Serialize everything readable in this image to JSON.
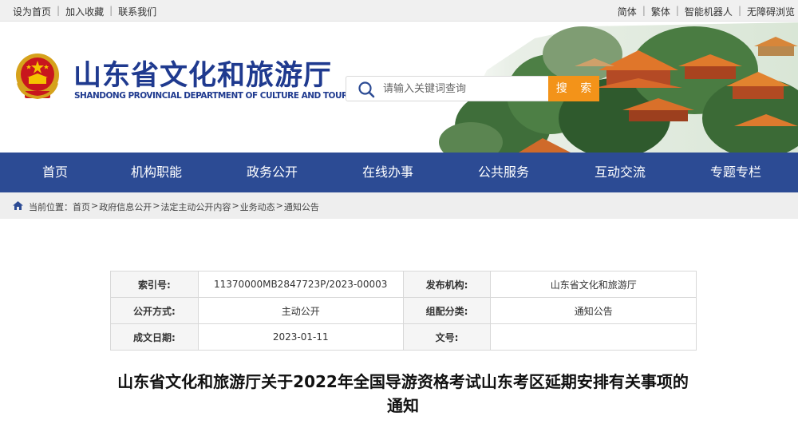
{
  "topbar": {
    "left_links": [
      "设为首页",
      "加入收藏",
      "联系我们"
    ],
    "right_links": [
      "简体",
      "繁体",
      "智能机器人",
      "无障碍浏览"
    ]
  },
  "header": {
    "title": "山东省文化和旅游厅",
    "subtitle": "SHANDONG PROVINCIAL DEPARTMENT OF CULTURE AND TOURISM",
    "emblem_icon": "national-emblem-icon",
    "search": {
      "placeholder": "请输入关键词查询",
      "button": "搜 索"
    }
  },
  "nav": {
    "items": [
      "首页",
      "机构职能",
      "政务公开",
      "在线办事",
      "公共服务",
      "互动交流",
      "专题专栏"
    ]
  },
  "breadcrumb": {
    "label": "当前位置：",
    "items": [
      "首页",
      "政府信息公开",
      "法定主动公开内容",
      "业务动态",
      "通知公告"
    ],
    "separator": ">"
  },
  "meta": {
    "index_label": "索引号:",
    "index_value": "11370000MB2847723P/2023-00003",
    "org_label": "发布机构:",
    "org_value": "山东省文化和旅游厅",
    "mode_label": "公开方式:",
    "mode_value": "主动公开",
    "category_label": "组配分类:",
    "category_value": "通知公告",
    "date_label": "成文日期:",
    "date_value": "2023-01-11",
    "docno_label": "文号:",
    "docno_value": ""
  },
  "article": {
    "title_line1": "山东省文化和旅游厅关于2022年全国导游资格考试山东考区延期安排有关事项的",
    "title_line2": "通知"
  },
  "colors": {
    "nav_bg": "#2c4b94",
    "brand_blue": "#1f3a8f",
    "search_button": "#f39319"
  }
}
